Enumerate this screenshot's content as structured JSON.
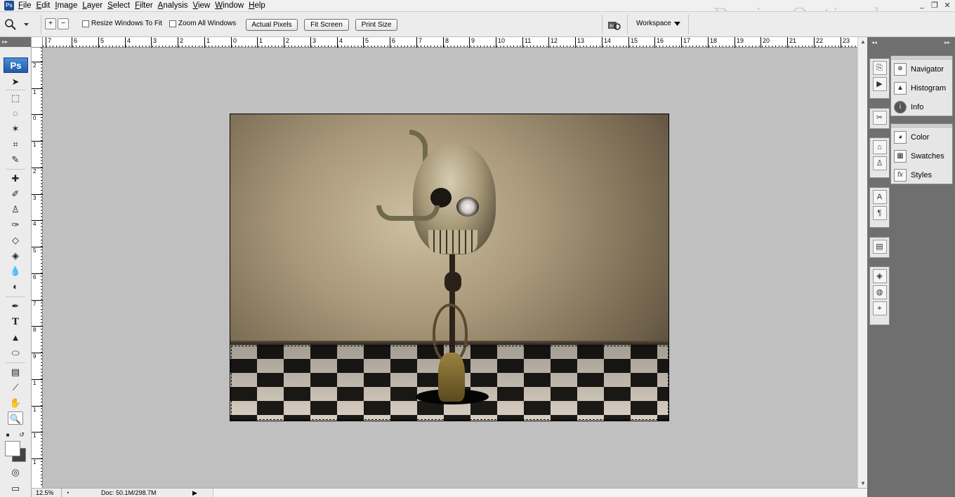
{
  "menubar": {
    "app_icon": "Ps",
    "items": [
      "File",
      "Edit",
      "Image",
      "Layer",
      "Select",
      "Filter",
      "Analysis",
      "View",
      "Window",
      "Help"
    ],
    "watermark": "DesignOptimal.com",
    "window_controls": [
      "_",
      "❐",
      "✕"
    ]
  },
  "options": {
    "resize_windows_label": "Resize Windows To Fit",
    "zoom_all_label": "Zoom All Windows",
    "actual_pixels": "Actual Pixels",
    "fit_screen": "Fit Screen",
    "print_size": "Print Size",
    "workspace": "Workspace"
  },
  "ruler_top": [
    "7",
    "6",
    "5",
    "4",
    "3",
    "2",
    "1",
    "0",
    "1",
    "2",
    "3",
    "4",
    "5",
    "6",
    "7",
    "8",
    "9",
    "10",
    "11",
    "12",
    "13",
    "14",
    "15",
    "16",
    "17",
    "18",
    "19",
    "20",
    "21",
    "22",
    "23"
  ],
  "ruler_left": [
    "2",
    "1",
    "0",
    "1",
    "2",
    "3",
    "4",
    "5",
    "6",
    "7",
    "8",
    "9",
    "1",
    "1",
    "1",
    "1"
  ],
  "toolbox": {
    "badge": "Ps",
    "tools": [
      "move-tool",
      "marquee-tool",
      "lasso-tool",
      "magic-wand-tool",
      "crop-tool",
      "slice-tool",
      "healing-tool",
      "brush-tool",
      "stamp-tool",
      "history-brush-tool",
      "eraser-tool",
      "paint-bucket-tool",
      "blur-tool",
      "dodge-tool",
      "pen-tool",
      "type-tool",
      "path-select-tool",
      "shape-tool",
      "notes-tool",
      "eyedropper-tool",
      "hand-tool",
      "zoom-tool"
    ]
  },
  "status": {
    "zoom": "12.5%",
    "doc": "Doc: 50.1M/298.7M"
  },
  "panels": {
    "group1": [
      "Navigator",
      "Histogram",
      "Info"
    ],
    "group2": [
      "Color",
      "Swatches",
      "Styles"
    ]
  },
  "colors": {
    "canvas_bg": "#c0c0c0",
    "dock_bg": "#6f6f6f",
    "foreground": "#ffffff",
    "background": "#444444"
  }
}
